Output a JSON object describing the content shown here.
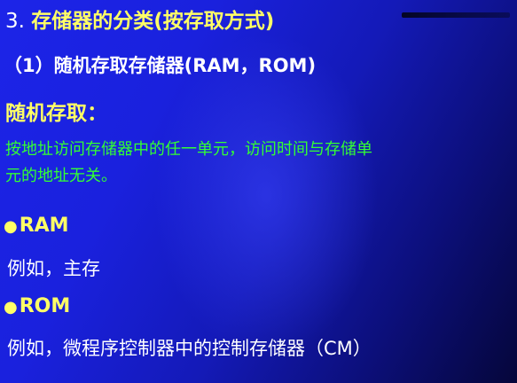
{
  "title": {
    "number": "3.",
    "main": "存储器的分类",
    "paren": "(按存取方式)"
  },
  "subtitle": "（1）随机存取存储器(RAM，ROM)",
  "definition": {
    "heading": "随机存取：",
    "lines": [
      "按地址访问存储器中的任一单元，访问时间与存储单",
      "元的地址无关。"
    ]
  },
  "items": [
    {
      "bullet": "●",
      "label": "RAM",
      "example": "例如，主存"
    },
    {
      "bullet": "●",
      "label": "ROM",
      "example": "例如，微程序控制器中的控制存储器（CM）"
    }
  ],
  "colors": {
    "background": "#1a21dd",
    "title_yellow": "#ffff66",
    "body_green": "#33ff33",
    "text_white": "#ffffff"
  }
}
